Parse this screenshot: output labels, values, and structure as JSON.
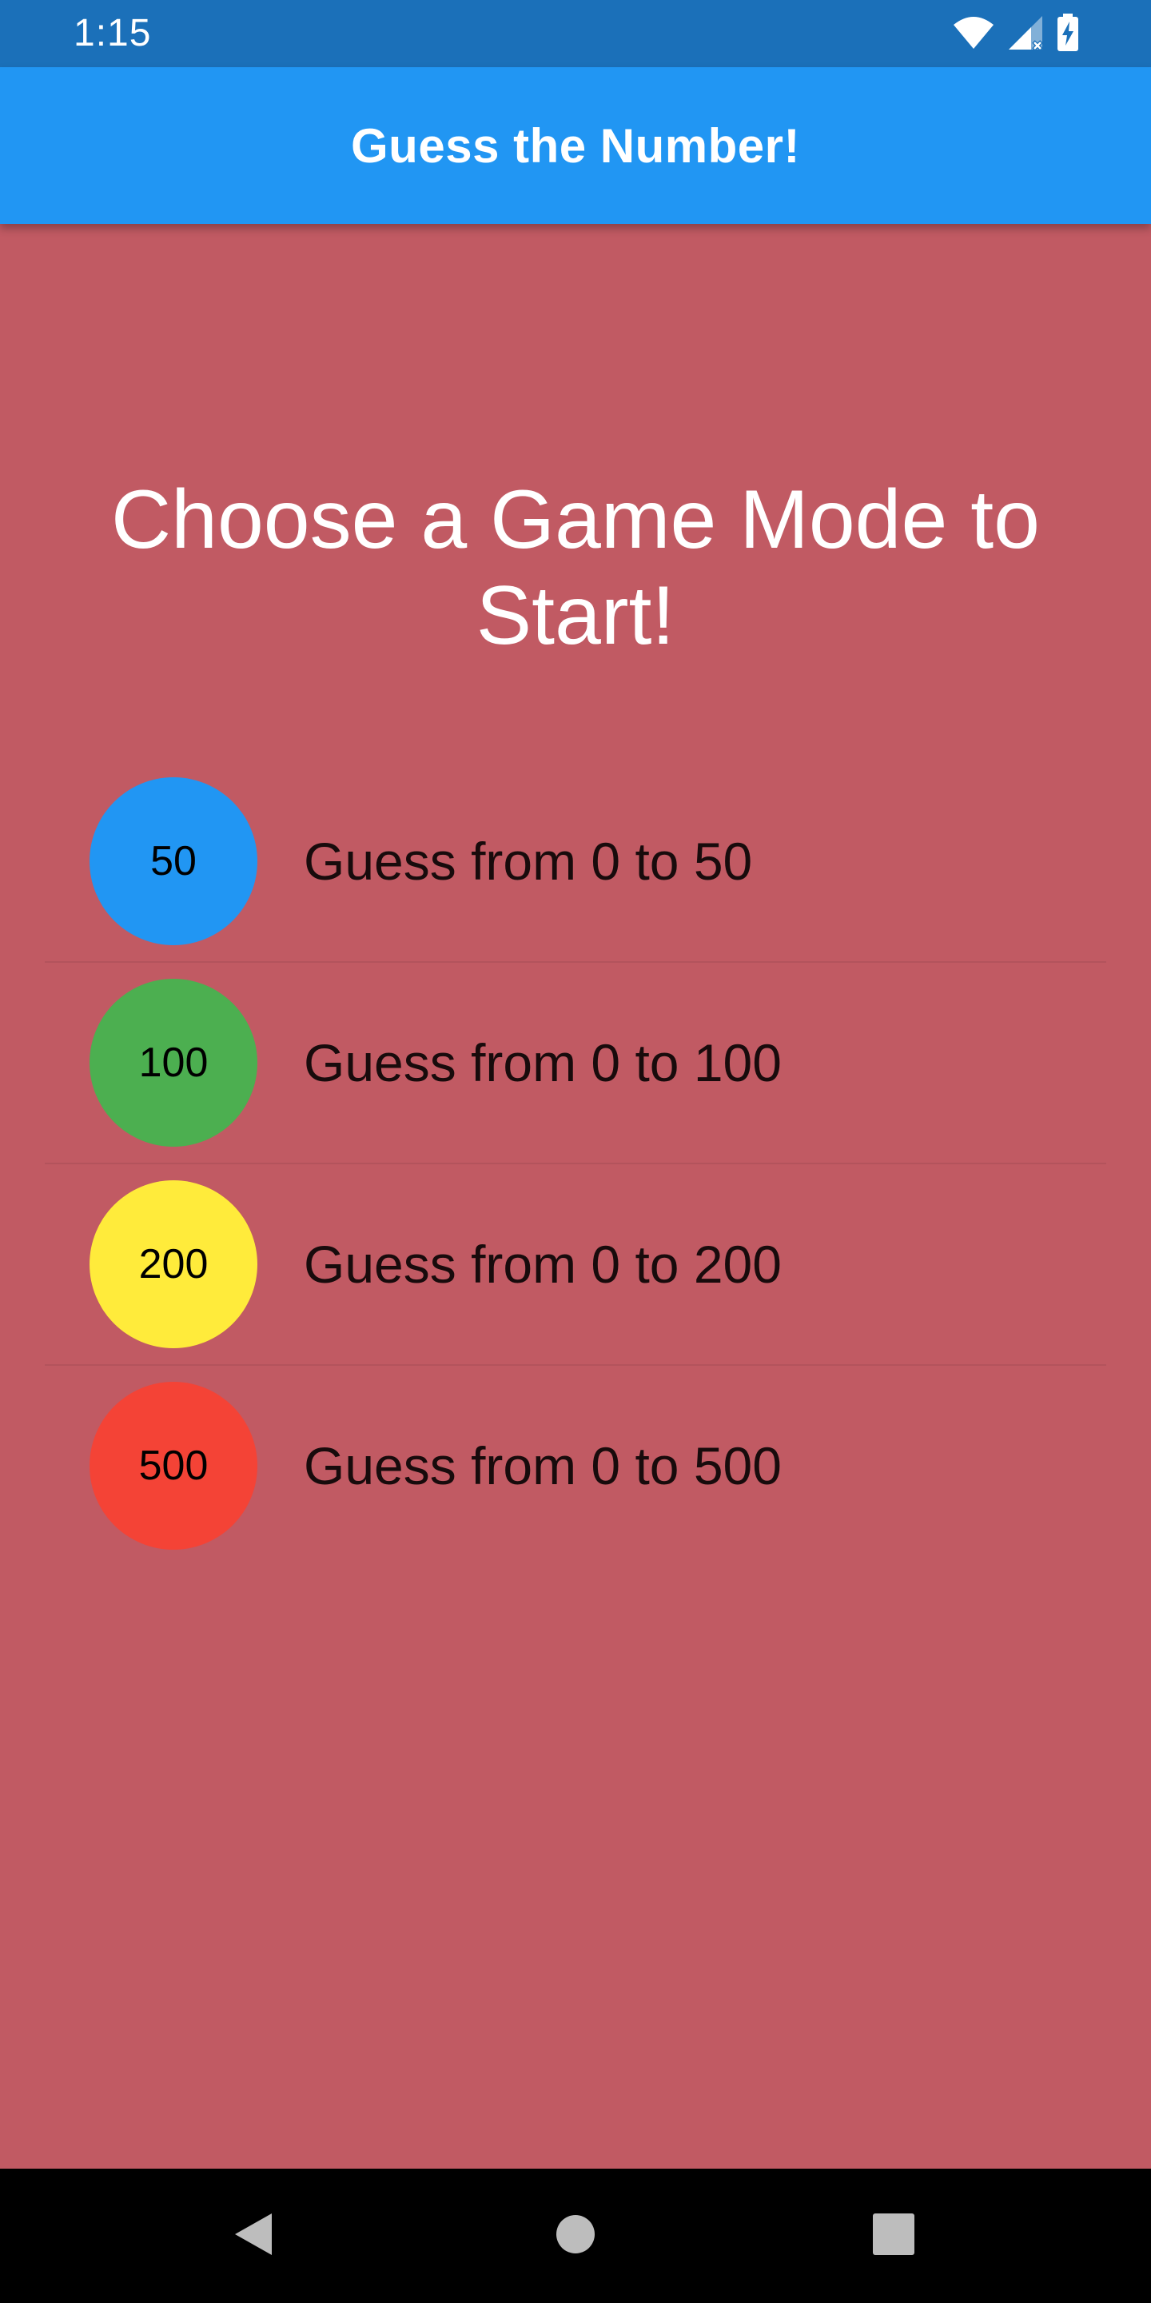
{
  "status_bar": {
    "time": "1:15",
    "icons": [
      "wifi-icon",
      "cell-signal-icon",
      "battery-charging-icon"
    ]
  },
  "app_bar": {
    "title": "Guess the Number!"
  },
  "main": {
    "heading": "Choose a Game Mode to Start!",
    "modes": [
      {
        "badge": "50",
        "label": "Guess from 0 to 50",
        "color": "#2196F3"
      },
      {
        "badge": "100",
        "label": "Guess from 0 to 100",
        "color": "#4CAF50"
      },
      {
        "badge": "200",
        "label": "Guess from 0 to 200",
        "color": "#FFEB3B"
      },
      {
        "badge": "500",
        "label": "Guess from 0 to 500",
        "color": "#F44336"
      }
    ]
  },
  "nav_bar": {
    "icons": [
      "back-icon",
      "home-icon",
      "recents-icon"
    ]
  },
  "colors": {
    "status_bar": "#1B70B9",
    "app_bar": "#2196F3",
    "background": "#C15A63"
  }
}
